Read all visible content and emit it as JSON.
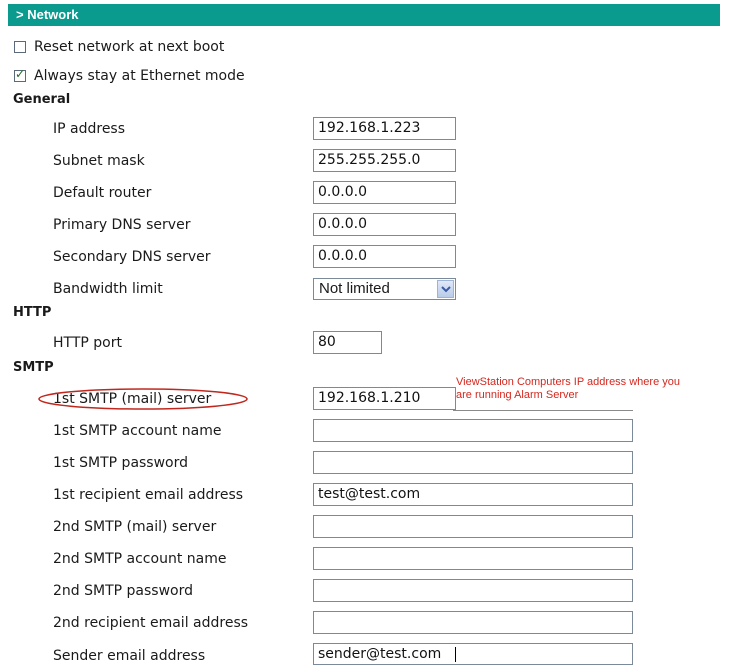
{
  "header": {
    "title": "> Network"
  },
  "options": {
    "reset_network": {
      "label": "Reset network at next boot",
      "checked": false
    },
    "ethernet_mode": {
      "label": "Always stay at Ethernet mode",
      "checked": true
    }
  },
  "general": {
    "title": "General",
    "ip_address": {
      "label": "IP address",
      "value": "192.168.1.223"
    },
    "subnet_mask": {
      "label": "Subnet mask",
      "value": "255.255.255.0"
    },
    "default_router": {
      "label": "Default router",
      "value": "0.0.0.0"
    },
    "primary_dns": {
      "label": "Primary DNS server",
      "value": "0.0.0.0"
    },
    "secondary_dns": {
      "label": "Secondary DNS server",
      "value": "0.0.0.0"
    },
    "bandwidth_limit": {
      "label": "Bandwidth limit",
      "value": "Not limited"
    }
  },
  "http": {
    "title": "HTTP",
    "port": {
      "label": "HTTP port",
      "value": "80"
    }
  },
  "smtp": {
    "title": "SMTP",
    "server1": {
      "label": "1st SMTP (mail) server",
      "value": "192.168.1.210"
    },
    "account1": {
      "label": "1st SMTP account name",
      "value": ""
    },
    "password1": {
      "label": "1st SMTP password",
      "value": ""
    },
    "recipient1": {
      "label": "1st recipient email address",
      "value": "test@test.com"
    },
    "server2": {
      "label": "2nd SMTP (mail) server",
      "value": ""
    },
    "account2": {
      "label": "2nd SMTP account name",
      "value": ""
    },
    "password2": {
      "label": "2nd SMTP password",
      "value": ""
    },
    "recipient2": {
      "label": "2nd recipient email address",
      "value": ""
    },
    "sender": {
      "label": "Sender email address",
      "value": "sender@test.com"
    }
  },
  "annotation": {
    "line1": "ViewStation Computers IP address where you",
    "line2": "are running Alarm Server"
  },
  "colors": {
    "header_bg": "#0a9a8e",
    "annotation": "#d4281f",
    "highlight_ellipse": "#c0281f"
  }
}
